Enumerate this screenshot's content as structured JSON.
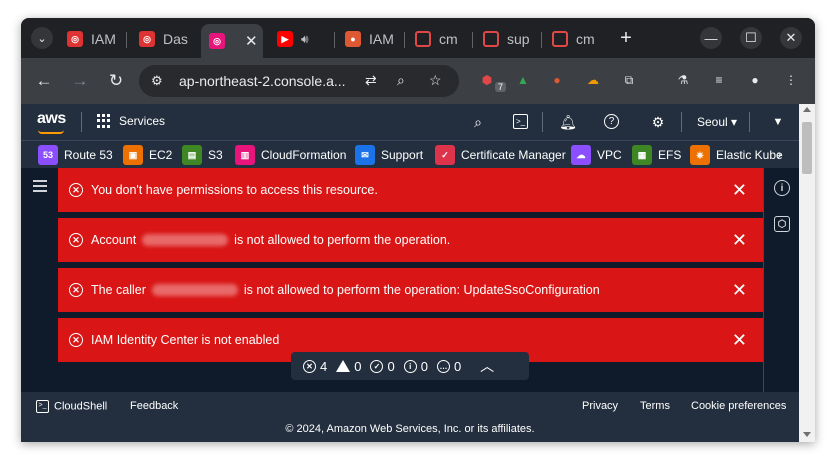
{
  "browser": {
    "tabs": [
      {
        "label": "IAM",
        "favicon": "aws-red-icon"
      },
      {
        "label": "Das",
        "favicon": "aws-red-icon"
      },
      {
        "label": "",
        "favicon": "aws-pink-icon",
        "active": true
      },
      {
        "label": "",
        "favicon": "youtube-icon"
      },
      {
        "label": "IAM",
        "favicon": "duckduckgo-icon"
      },
      {
        "label": "cm",
        "favicon": "aws-outline-icon"
      },
      {
        "label": "sup",
        "favicon": "aws-outline-icon"
      },
      {
        "label": "cm",
        "favicon": "aws-outline-icon"
      }
    ],
    "url": "ap-northeast-2.console.a...",
    "extension_badge": "7"
  },
  "aws": {
    "logo": "aws",
    "services_label": "Services",
    "region": "Seoul",
    "favorites": [
      {
        "label": "Route 53",
        "color": "#8c4fff"
      },
      {
        "label": "EC2",
        "color": "#ed7100"
      },
      {
        "label": "S3",
        "color": "#3f8624"
      },
      {
        "label": "CloudFormation",
        "color": "#e7157b"
      },
      {
        "label": "Support",
        "color": "#1a73e8"
      },
      {
        "label": "Certificate Manager",
        "color": "#dd344c"
      },
      {
        "label": "VPC",
        "color": "#8c4fff"
      },
      {
        "label": "EFS",
        "color": "#3f8624"
      },
      {
        "label": "Elastic Kube",
        "color": "#ed7100"
      }
    ]
  },
  "flashbar": [
    {
      "pre": "You don't have permissions to access this resource.",
      "post": "",
      "redacted": false
    },
    {
      "pre": "Account",
      "post": "is not allowed to perform the operation.",
      "redacted": true
    },
    {
      "pre": "The caller",
      "post": "is not allowed to perform the operation: UpdateSsoConfiguration",
      "redacted": true
    },
    {
      "pre": "IAM Identity Center is not enabled",
      "post": "",
      "redacted": false
    }
  ],
  "notification_counts": {
    "error": "4",
    "warning": "0",
    "success": "0",
    "info": "0",
    "in_progress": "0"
  },
  "footer": {
    "cloudshell": "CloudShell",
    "feedback": "Feedback",
    "privacy": "Privacy",
    "terms": "Terms",
    "cookies": "Cookie preferences",
    "copyright": "© 2024, Amazon Web Services, Inc. or its affiliates."
  }
}
